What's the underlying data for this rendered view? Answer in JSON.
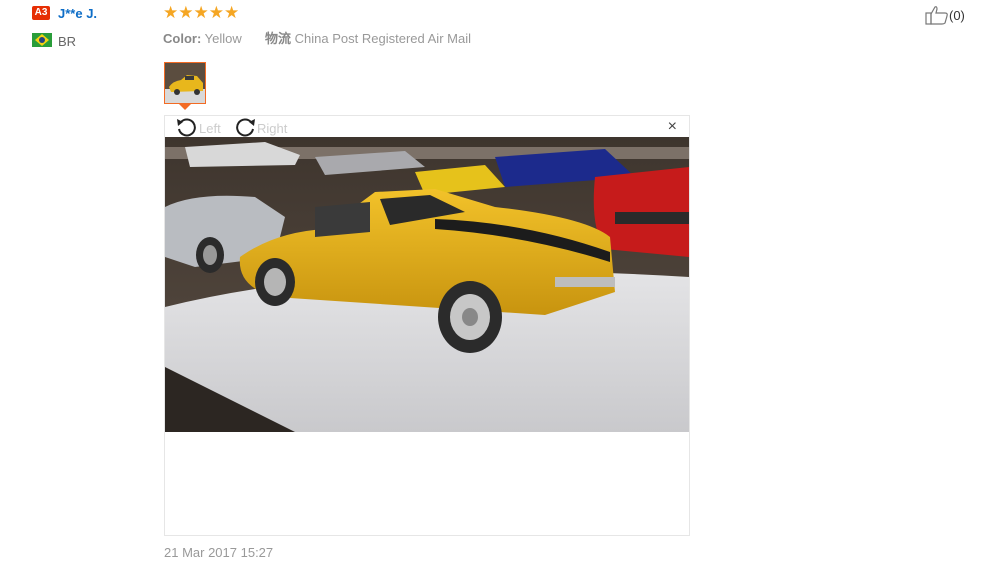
{
  "reviewer": {
    "level_badge": "A3",
    "name": "J**e J.",
    "country_code": "BR",
    "flag_icon": "brazil-flag-icon"
  },
  "review": {
    "stars": "★★★★★",
    "rating": 5,
    "color_label": "Color:",
    "color_value": "Yellow",
    "shipping_label": "物流",
    "shipping_value": "China Post Registered Air Mail",
    "date": "21 Mar 2017 15:27"
  },
  "helpful": {
    "count": "(0)",
    "icon": "thumbs-up-icon"
  },
  "viewer": {
    "rotate_left_label": "Left",
    "rotate_right_label": "Right",
    "close_label": "×",
    "photo_icon": "review-photo-yellow-car"
  },
  "colors": {
    "accent": "#f36b24",
    "link": "#0d6dc7",
    "badge": "#e62e04",
    "star": "#f5a623"
  }
}
